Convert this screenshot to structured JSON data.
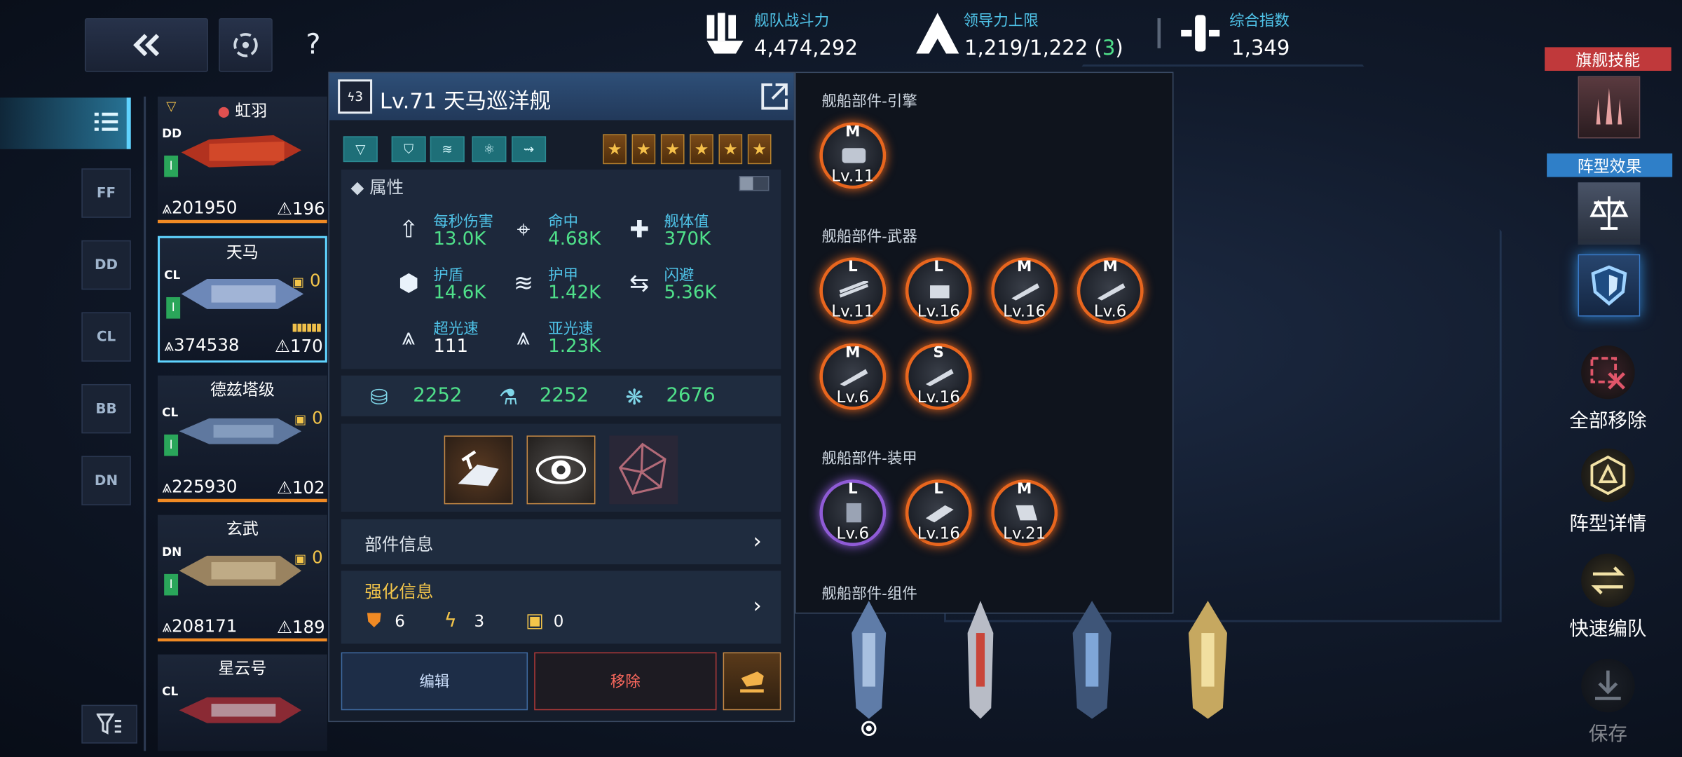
{
  "top": {
    "fleet_power_label": "舰队战斗力",
    "fleet_power": "4,474,292",
    "command_label": "领导力上限",
    "command_value": "1,219/1,222",
    "command_open": " (",
    "command_extra": "3",
    "command_close": ")",
    "index_label": "综合指数",
    "index_value": "1,349"
  },
  "sidebar": {
    "filters": [
      "FF",
      "DD",
      "CL",
      "BB",
      "DN"
    ]
  },
  "cards": [
    {
      "name": "虹羽",
      "cls": "DD",
      "lv": "I",
      "power": "201950",
      "cmd": "196",
      "count": ""
    },
    {
      "name": "天马",
      "cls": "CL",
      "lv": "I",
      "power": "374538",
      "cmd": "170",
      "count": "0"
    },
    {
      "name": "德兹塔级",
      "cls": "CL",
      "lv": "I",
      "power": "225930",
      "cmd": "102",
      "count": "0"
    },
    {
      "name": "玄武",
      "cls": "DN",
      "lv": "I",
      "power": "208171",
      "cmd": "189",
      "count": "0"
    },
    {
      "name": "星云号",
      "cls": "CL",
      "lv": "",
      "power": "",
      "cmd": "",
      "count": ""
    }
  ],
  "panel": {
    "badge": "3",
    "title": "Lv.71 天马巡洋舰",
    "attr_title": "属性",
    "attrs": [
      {
        "label": "每秒伤害",
        "value": "13.0K",
        "icon": "dps-icon"
      },
      {
        "label": "命中",
        "value": "4.68K",
        "icon": "crosshair-icon"
      },
      {
        "label": "舰体值",
        "value": "370K",
        "icon": "hull-icon"
      },
      {
        "label": "护盾",
        "value": "14.6K",
        "icon": "shield-icon"
      },
      {
        "label": "护甲",
        "value": "1.42K",
        "icon": "armor-icon"
      },
      {
        "label": "闪避",
        "value": "5.36K",
        "icon": "evade-icon"
      },
      {
        "label": "超光速",
        "value": "111",
        "icon": "warp-icon"
      },
      {
        "label": "亚光速",
        "value": "1.23K",
        "icon": "sublight-icon"
      }
    ],
    "resources": [
      "2252",
      "2252",
      "2676"
    ],
    "parts_info": "部件信息",
    "enhance_title": "强化信息",
    "enhance": [
      "6",
      "3",
      "0"
    ],
    "edit": "编辑",
    "remove": "移除"
  },
  "modules": {
    "engine_title": "舰船部件-引擎",
    "engine": [
      {
        "g": "M",
        "lv": "Lv.11"
      }
    ],
    "weapon_title": "舰船部件-武器",
    "weapon": [
      {
        "g": "L",
        "lv": "Lv.11"
      },
      {
        "g": "L",
        "lv": "Lv.16"
      },
      {
        "g": "M",
        "lv": "Lv.16"
      },
      {
        "g": "M",
        "lv": "Lv.6"
      },
      {
        "g": "M",
        "lv": "Lv.6"
      },
      {
        "g": "S",
        "lv": "Lv.16"
      }
    ],
    "armor_title": "舰船部件-装甲",
    "armor": [
      {
        "g": "L",
        "lv": "Lv.6"
      },
      {
        "g": "L",
        "lv": "Lv.16"
      },
      {
        "g": "M",
        "lv": "Lv.21"
      }
    ],
    "component_title": "舰船部件-组件"
  },
  "right": {
    "flagship_skill": "旗舰技能",
    "formation_effect": "阵型效果",
    "remove_all": "全部移除",
    "formation_detail": "阵型详情",
    "quick_fleet": "快速编队",
    "save": "保存"
  },
  "colors": {
    "accent": "#4fc3e8",
    "green": "#4fe08a",
    "orange": "#f08a24",
    "skill_red": "#c0393b",
    "effect_blue": "#2f7fc8"
  }
}
